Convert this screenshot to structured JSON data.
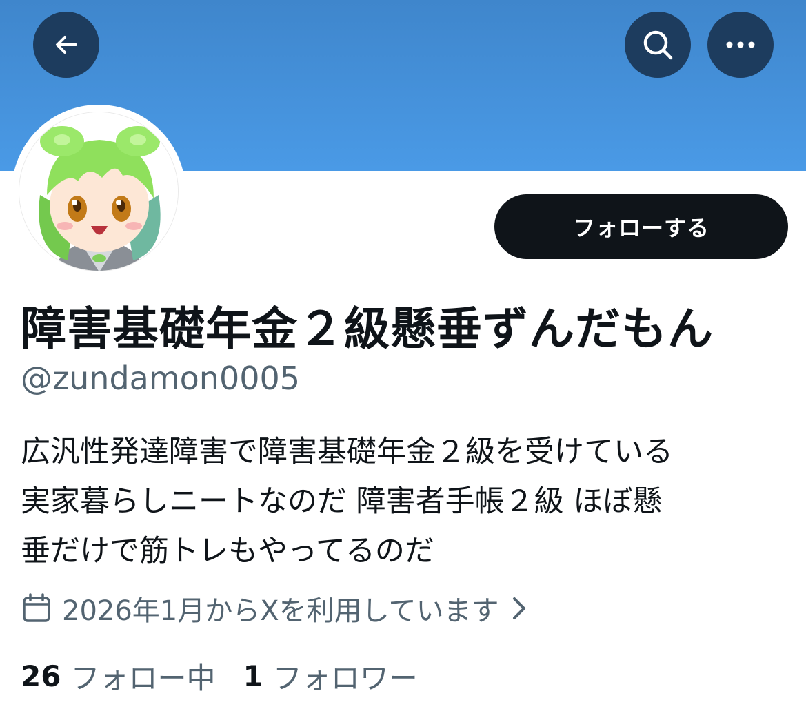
{
  "header": {
    "back_icon": "arrow-left-icon",
    "search_icon": "search-icon",
    "more_icon": "more-horizontal-icon",
    "banner_color": "#4a9ae6",
    "button_bg": "#1d3c5e"
  },
  "profile": {
    "display_name": "障害基礎年金２級懸垂ずんだもん",
    "handle": "@zundamon0005",
    "follow_label": "フォローする",
    "bio_lines": [
      "広汎性発達障害で障害基礎年金２級を受けている",
      "実家暮らしニートなのだ 障害者手帳２級 ほぼ懸",
      "垂だけで筋トレもやってるのだ"
    ],
    "joined": "2026年1月からXを利用しています",
    "following_count": "26",
    "following_label": "フォロー中",
    "followers_count": "1",
    "followers_label": "フォロワー"
  },
  "colors": {
    "text_primary": "#0f1419",
    "text_secondary": "#536471",
    "follow_button_bg": "#0f1419"
  }
}
